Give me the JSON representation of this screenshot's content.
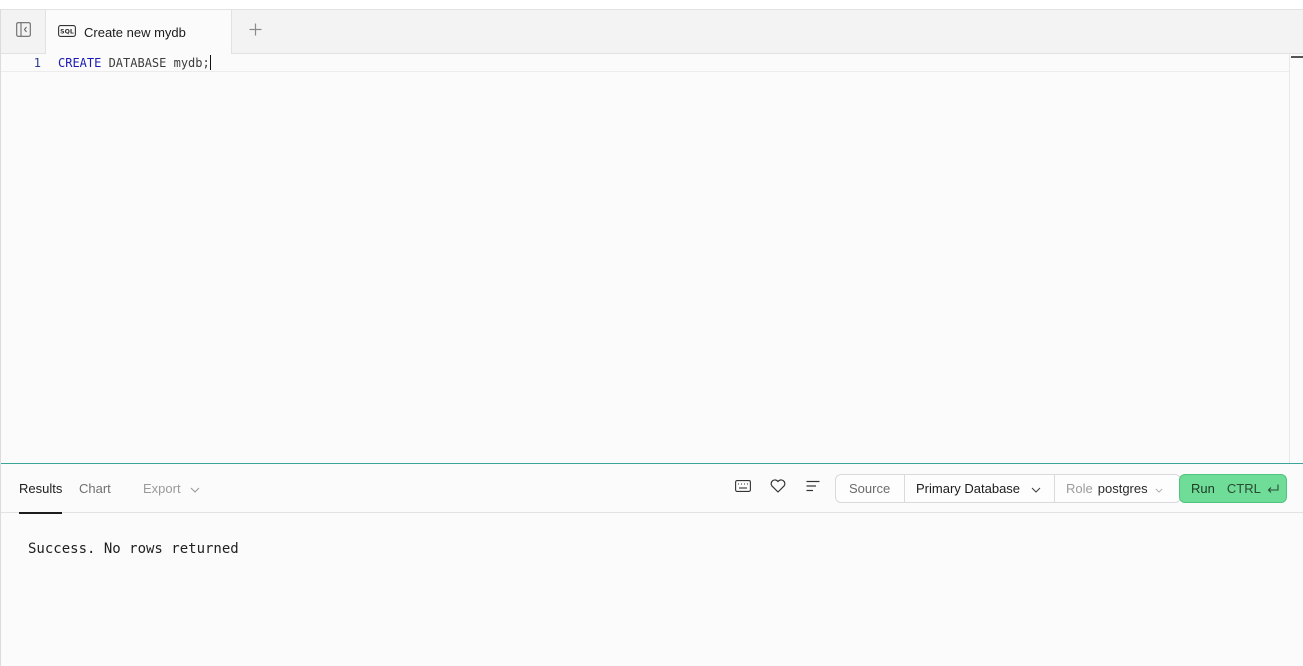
{
  "tabbar": {
    "sidebar_toggle_icon": "sidebar-collapse-icon",
    "tabs": [
      {
        "icon": "sql-file-icon",
        "icon_text": "SQL",
        "label": "Create new mydb"
      }
    ],
    "add_tab_icon": "plus-icon"
  },
  "editor": {
    "lines": [
      {
        "number": "1",
        "keyword": "CREATE",
        "rest": " DATABASE mydb;"
      }
    ]
  },
  "results": {
    "tabs": {
      "results": "Results",
      "chart": "Chart",
      "export": "Export"
    },
    "toolbar_icons": [
      "keyboard-icon",
      "heart-icon",
      "align-left-icon"
    ],
    "source_label": "Source",
    "database": "Primary Database",
    "role_label": "Role",
    "role_value": "postgres",
    "run": {
      "label": "Run",
      "shortcut": "CTRL",
      "shortcut_icon": "enter-icon",
      "color": "#6fdc97"
    },
    "message": "Success. No rows returned"
  },
  "colors": {
    "accent_border": "#3aa59a",
    "keyword": "#1a1ab4",
    "line_number": "#2b3a8f"
  }
}
